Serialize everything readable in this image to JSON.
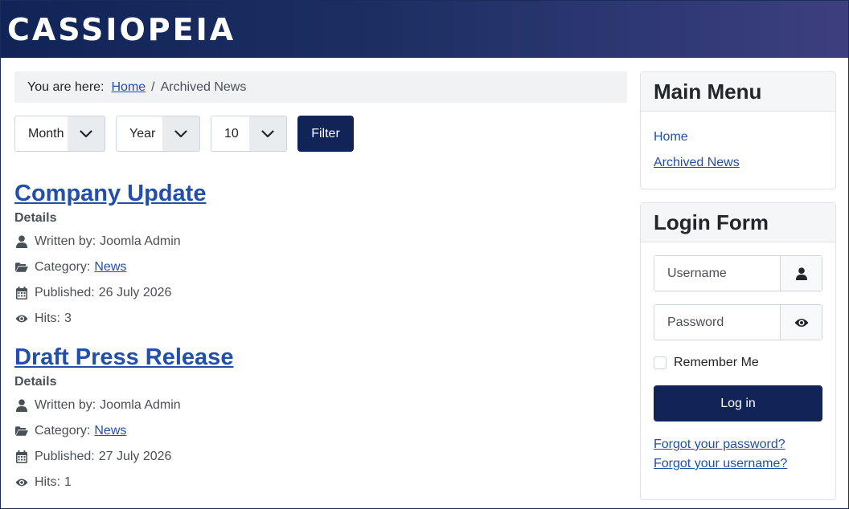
{
  "site": {
    "logo": "CASSIOPEIA"
  },
  "breadcrumb": {
    "prefix": "You are here:",
    "home": "Home",
    "separator": "/",
    "current": "Archived News"
  },
  "filters": {
    "month": "Month",
    "year": "Year",
    "limit": "10",
    "button": "Filter"
  },
  "articles": [
    {
      "title": "Company Update",
      "details_label": "Details",
      "author_label": "Written by:",
      "author": "Joomla Admin",
      "category_label": "Category:",
      "category": "News",
      "published_label": "Published:",
      "published": "26 July 2026",
      "hits_label": "Hits:",
      "hits": "3"
    },
    {
      "title": "Draft Press Release",
      "details_label": "Details",
      "author_label": "Written by:",
      "author": "Joomla Admin",
      "category_label": "Category:",
      "category": "News",
      "published_label": "Published:",
      "published": "27 July 2026",
      "hits_label": "Hits:",
      "hits": "1"
    }
  ],
  "main_menu": {
    "title": "Main Menu",
    "items": [
      "Home",
      "Archived News"
    ]
  },
  "login": {
    "title": "Login Form",
    "username_placeholder": "Username",
    "password_placeholder": "Password",
    "remember": "Remember Me",
    "button": "Log in",
    "forgot_password": "Forgot your password?",
    "forgot_username": "Forgot your username?"
  },
  "icons": {
    "author": "user-icon",
    "category": "folder-open-icon",
    "published": "calendar-icon",
    "hits": "eye-icon",
    "username_addon": "user-icon",
    "password_addon": "eye-icon",
    "select_chevron": "chevron-down-icon"
  },
  "colors": {
    "primary": "#112457",
    "link": "#224faa"
  }
}
